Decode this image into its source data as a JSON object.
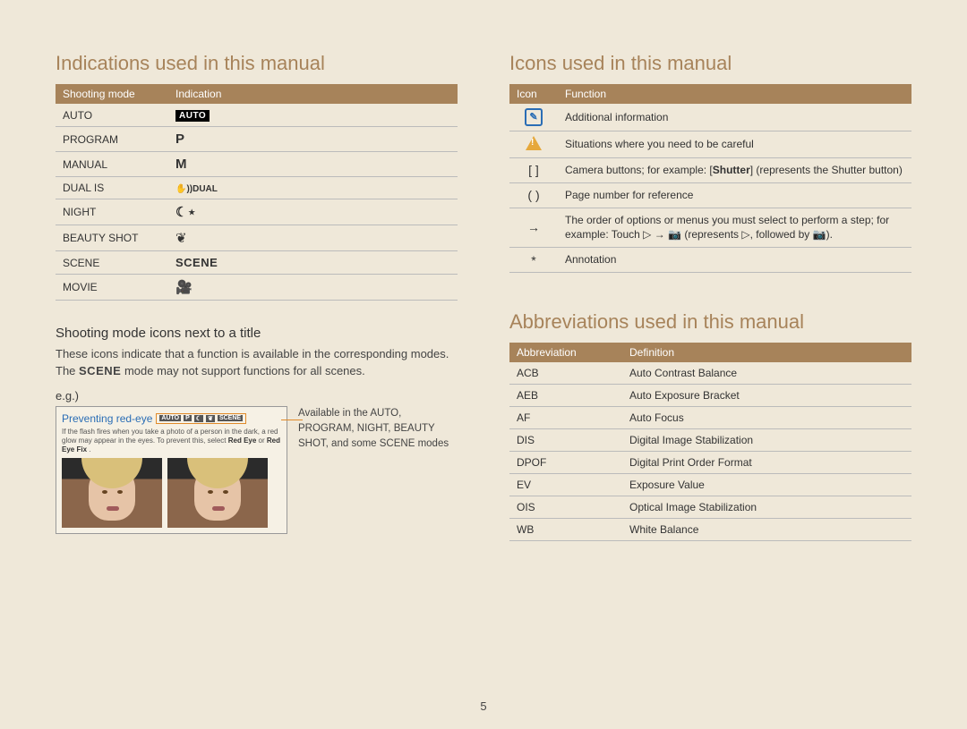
{
  "left": {
    "heading": "Indications used in this manual",
    "table": {
      "head": {
        "c1": "Shooting mode",
        "c2": "Indication"
      },
      "rows": [
        {
          "mode": "AUTO",
          "ind_type": "auto",
          "ind_text": "AUTO"
        },
        {
          "mode": "PROGRAM",
          "ind_type": "P",
          "ind_text": "P"
        },
        {
          "mode": "MANUAL",
          "ind_type": "M",
          "ind_text": "M"
        },
        {
          "mode": "DUAL IS",
          "ind_type": "dual",
          "ind_text": "✋))DUAL"
        },
        {
          "mode": "NIGHT",
          "ind_type": "night",
          "ind_text": "☾⋆"
        },
        {
          "mode": "BEAUTY SHOT",
          "ind_type": "beauty",
          "ind_text": "❦"
        },
        {
          "mode": "SCENE",
          "ind_type": "scene",
          "ind_text": "SCENE"
        },
        {
          "mode": "MOVIE",
          "ind_type": "movie",
          "ind_text": "🎥"
        }
      ]
    },
    "sub_heading": "Shooting mode icons next to a title",
    "body_pre": "These icons indicate that a function is available in the corresponding modes. The ",
    "body_scene": "SCENE",
    "body_post": " mode may not support functions for all scenes.",
    "eg_label": "e.g.)",
    "eg": {
      "title": "Preventing red-eye",
      "badges": [
        "AUTO",
        "P",
        "☾",
        "❦",
        "SCENE"
      ],
      "desc_pre": "If the flash fires when you take a photo of a person in the dark, a red glow may appear in the eyes. To prevent this, select ",
      "desc_b1": "Red Eye",
      "desc_mid": " or ",
      "desc_b2": "Red Eye Fix",
      "desc_post": "."
    },
    "eg_side": "Available in the AUTO, PROGRAM, NIGHT, BEAUTY SHOT, and some SCENE modes"
  },
  "right_top": {
    "heading": "Icons used in this manual",
    "table": {
      "head": {
        "c1": "Icon",
        "c2": "Function"
      },
      "rows": [
        {
          "icon": "note",
          "func": "Additional information"
        },
        {
          "icon": "warn",
          "func": "Situations where you need to be careful"
        },
        {
          "icon": "[  ]",
          "func_pre": "Camera buttons; for example: [",
          "func_b": "Shutter",
          "func_post": "] (represents the Shutter button)"
        },
        {
          "icon": "(  )",
          "func": "Page number for reference"
        },
        {
          "icon": "→",
          "func": "The order of options or menus you must select to perform a step; for example: Touch ▷ → 📷 (represents ▷, followed by 📷)."
        },
        {
          "icon": "*",
          "func": "Annotation"
        }
      ]
    }
  },
  "right_bottom": {
    "heading": "Abbreviations used in this manual",
    "table": {
      "head": {
        "c1": "Abbreviation",
        "c2": "Definition"
      },
      "rows": [
        {
          "abbr": "ACB",
          "def": "Auto Contrast Balance"
        },
        {
          "abbr": "AEB",
          "def": "Auto Exposure Bracket"
        },
        {
          "abbr": "AF",
          "def": "Auto Focus"
        },
        {
          "abbr": "DIS",
          "def": "Digital Image Stabilization"
        },
        {
          "abbr": "DPOF",
          "def": "Digital Print Order Format"
        },
        {
          "abbr": "EV",
          "def": "Exposure Value"
        },
        {
          "abbr": "OIS",
          "def": "Optical Image Stabilization"
        },
        {
          "abbr": "WB",
          "def": "White Balance"
        }
      ]
    }
  },
  "page_number": "5"
}
